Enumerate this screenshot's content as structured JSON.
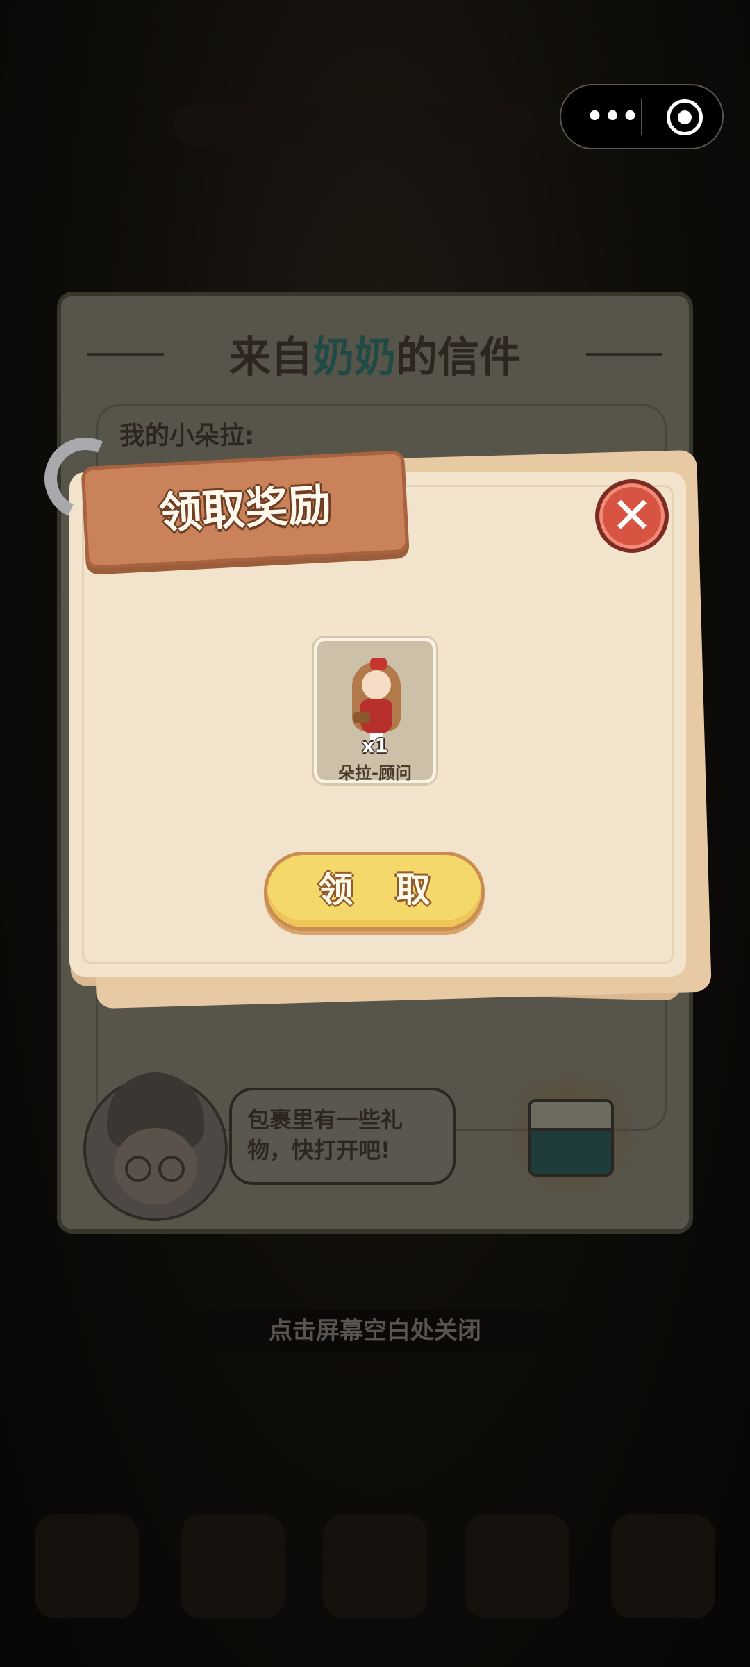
{
  "letter": {
    "title_prefix": "来自",
    "title_highlight": "奶奶",
    "title_suffix": "的信件",
    "greeting": "我的小朵拉:",
    "speech": "包裹里有一些礼物，快打开吧!"
  },
  "reward_popup": {
    "title": "领取奖励",
    "close_symbol": "✕",
    "item": {
      "quantity": "x1",
      "name": "朵拉-顾问"
    },
    "claim_label": "领 取"
  },
  "close_hint": "点击屏幕空白处关闭",
  "capsule": {
    "menu_symbol": "•••"
  },
  "colors": {
    "ribbon": "#c9825a",
    "claim_button": "#f5d86a",
    "close_button": "#d75443",
    "popup_bg": "#f2e4cc",
    "title_highlight": "#1f4a45"
  }
}
